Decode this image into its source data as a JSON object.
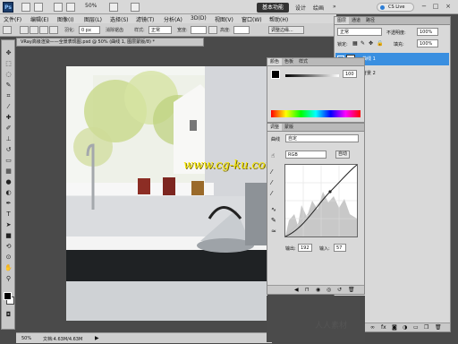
{
  "app": {
    "logo": "Ps",
    "zoom": "50%",
    "workspace_btn": "基本功能",
    "workspace_design": "设计",
    "workspace_paint": "绘画",
    "workspace_more": "»",
    "cslive": "CS Live"
  },
  "menu": [
    "文件(F)",
    "编辑(E)",
    "图像(I)",
    "图层(L)",
    "选择(S)",
    "滤镜(T)",
    "分析(A)",
    "3D(D)",
    "视图(V)",
    "窗口(W)",
    "帮助(H)"
  ],
  "options": {
    "feather_label": "羽化:",
    "feather_value": "0 px",
    "antialias": "消除锯齿",
    "style_label": "样式:",
    "style_value": "正常",
    "width_label": "宽度:",
    "height_label": "高度:",
    "refine": "调整边缘..."
  },
  "document": {
    "tab": "VRay高级渲染——全景表现图.psd @ 50% (曲线 1, 图层蒙版/8) *",
    "status_zoom": "50%",
    "status_doc": "文档:4.63M/4.63M"
  },
  "layers_panel": {
    "tabs": [
      "图层",
      "通道",
      "路径"
    ],
    "blend_mode": "正常",
    "opacity_label": "不透明度:",
    "opacity_value": "100%",
    "lock_label": "锁定:",
    "fill_label": "填充:",
    "fill_value": "100%",
    "layers": [
      {
        "name": "曲线 1",
        "selected": true
      },
      {
        "name": "背景 2",
        "selected": false
      }
    ]
  },
  "channels_panel": {
    "tabs": [
      "颜色",
      "色板",
      "样式"
    ],
    "value": "100"
  },
  "adjust_panel": {
    "tabs": [
      "调整",
      "蒙版"
    ],
    "preset_label": "曲线",
    "preset_value": "自定",
    "channel_value": "RGB",
    "auto_btn": "自动",
    "output_label": "输出:",
    "output_value": "192",
    "input_label": "输入:",
    "input_value": "57"
  },
  "watermark": "www.cg-ku.com",
  "watermark2": "人人素材",
  "colors": {
    "accent": "#3a8fe0",
    "ui_bg": "#d9d9d9",
    "dark": "#4a4a4a"
  }
}
